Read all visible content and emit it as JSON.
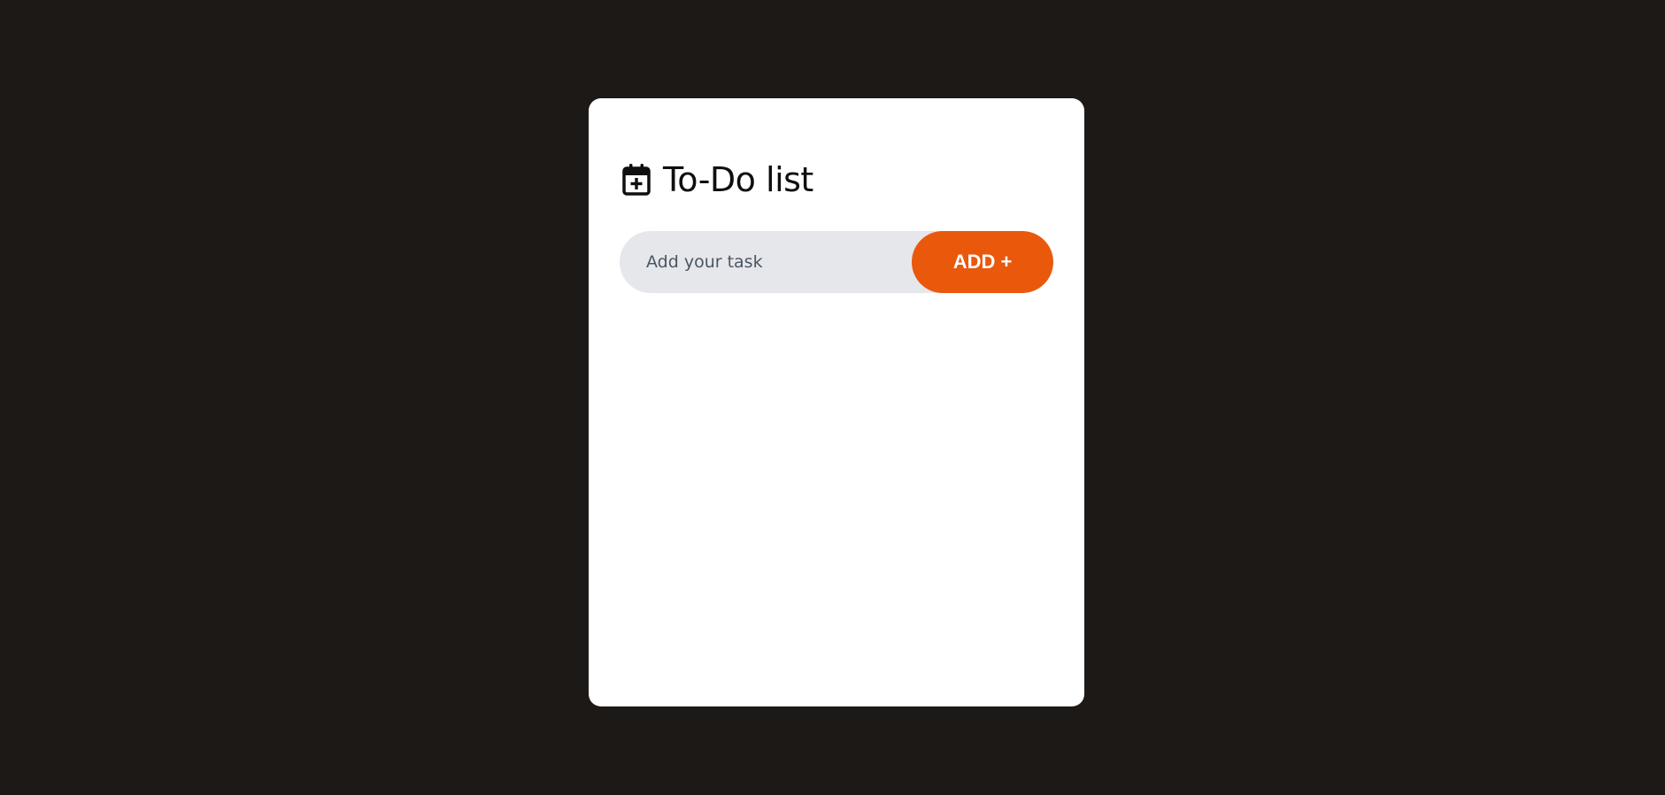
{
  "app": {
    "title": "To-Do list",
    "title_icon": "calendar-plus-icon"
  },
  "form": {
    "input_placeholder": "Add your task",
    "input_value": "",
    "add_button_label": "ADD +"
  },
  "tasks": [],
  "colors": {
    "page_background": "#1c1917",
    "card_background": "#ffffff",
    "input_background": "#e5e7eb",
    "accent": "#ea580c"
  }
}
